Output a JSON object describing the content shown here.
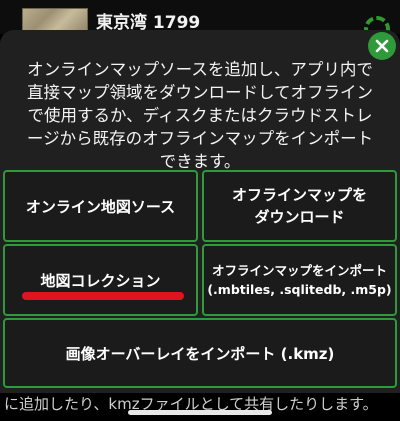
{
  "background": {
    "map_title": "東京湾 1799",
    "footer_text": "に追加したり、kmzファイルとして共有したりします。"
  },
  "dialog": {
    "description": "オンラインマップソースを追加し、アプリ内で直接マップ領域をダウンロードしてオフラインで使用するか、ディスクまたはクラウドストレージから既存のオフラインマップをインポートできます。",
    "options": {
      "online_source": "オンライン地図ソース",
      "download_line1": "オフラインマップを",
      "download_line2": "ダウンロード",
      "collection": "地図コレクション",
      "import_line1": "オフラインマップをインポート",
      "import_line2": "(.mbtiles, .sqlitedb, .m5p)",
      "overlay": "画像オーバーレイをインポート (.kmz)"
    }
  },
  "colors": {
    "accent": "#2e9a3a",
    "highlight": "#e0141e",
    "dialog_bg": "#202020"
  },
  "icons": {
    "close": "close-icon",
    "settings": "gear-icon"
  }
}
